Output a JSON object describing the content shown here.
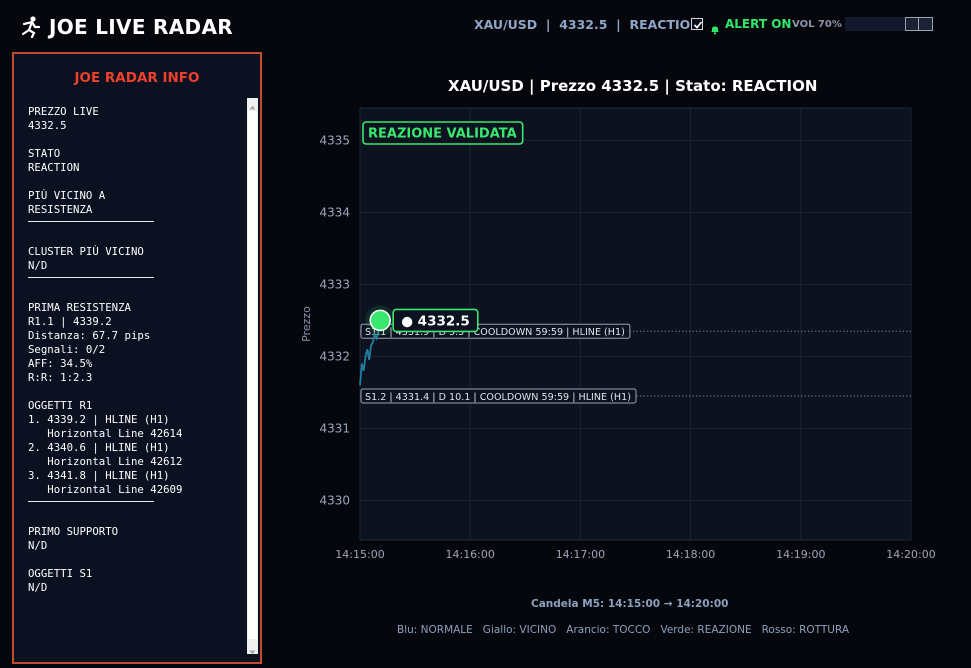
{
  "app": {
    "title": "JOE LIVE RADAR",
    "logo_icon": "runner-icon"
  },
  "header": {
    "symbol": "XAU/USD",
    "price": "4332.5",
    "state": "REACTION",
    "separator": "|",
    "alert_checked": true,
    "alert_label": "ALERT ON",
    "alert_icon": "bell-icon",
    "volume_label": "VOL 70%",
    "volume_level": 0.7
  },
  "panel": {
    "title": "JOE RADAR INFO",
    "lines": [
      "PREZZO LIVE",
      "4332.5",
      "",
      "STATO",
      "REACTION",
      "",
      "PIÙ VICINO A",
      "RESISTENZA",
      "---",
      "",
      "CLUSTER PIÙ VICINO",
      "N/D",
      "---",
      "",
      "PRIMA RESISTENZA",
      "R1.1 | 4339.2",
      "Distanza: 67.7 pips",
      "Segnali: 0/2",
      "AFF: 34.5%",
      "R:R: 1:2.3",
      "",
      "OGGETTI R1",
      "1. 4339.2 | HLINE (H1)",
      "   Horizontal Line 42614",
      "2. 4340.6 | HLINE (H1)",
      "   Horizontal Line 42612",
      "3. 4341.8 | HLINE (H1)",
      "   Horizontal Line 42609",
      "---",
      "",
      "PRIMO SUPPORTO",
      "N/D",
      "",
      "OGGETTI S1",
      "N/D"
    ]
  },
  "chart_data": {
    "type": "line",
    "title": "XAU/USD | Prezzo 4332.5 | Stato: REACTION",
    "xlabel": "",
    "ylabel": "Prezzo",
    "x_ticks": [
      "14:15:00",
      "14:16:00",
      "14:17:00",
      "14:18:00",
      "14:19:00",
      "14:20:00"
    ],
    "y_ticks": [
      4330,
      4331,
      4332,
      4333,
      4334,
      4335
    ],
    "xlim": [
      "14:15:00",
      "14:20:00"
    ],
    "ylim": [
      4329.45,
      4335.45
    ],
    "grid": true,
    "series": [
      {
        "x": [
          "14:15:00",
          "14:15:01",
          "14:15:02",
          "14:15:03",
          "14:15:04",
          "14:15:05",
          "14:15:06",
          "14:15:07",
          "14:15:08",
          "14:15:09",
          "14:15:10",
          "14:15:11"
        ],
        "y": [
          4331.6,
          4331.9,
          4331.8,
          4332.0,
          4332.1,
          4331.95,
          4332.15,
          4332.2,
          4332.3,
          4332.25,
          4332.35,
          4332.5
        ],
        "color": "#1f7fa0"
      }
    ],
    "current_point": {
      "x": "14:15:11",
      "y": 4332.5,
      "label": "● 4332.5",
      "color": "#39e86c"
    },
    "levels": [
      {
        "y": 4332.35,
        "label": "S1.1 | 4331.9 | D 5.5 | COOLDOWN 59:59 | HLINE (H1)"
      },
      {
        "y": 4331.45,
        "label": "S1.2 | 4331.4 | D 10.1 | COOLDOWN 59:59 | HLINE (H1)"
      }
    ],
    "badge": {
      "text": "REAZIONE VALIDATA",
      "color": "#39e86c"
    },
    "colors": {
      "background": "#0c1220",
      "grid": "#1b2433",
      "level_line": "#6a7488",
      "label_border": "#9aa3b2"
    }
  },
  "footer": {
    "candle": "Candela M5: 14:15:00 → 14:20:00",
    "legend": "Blu: NORMALE   Giallo: VICINO   Arancio: TOCCO   Verde: REAZIONE   Rosso: ROTTURA"
  }
}
